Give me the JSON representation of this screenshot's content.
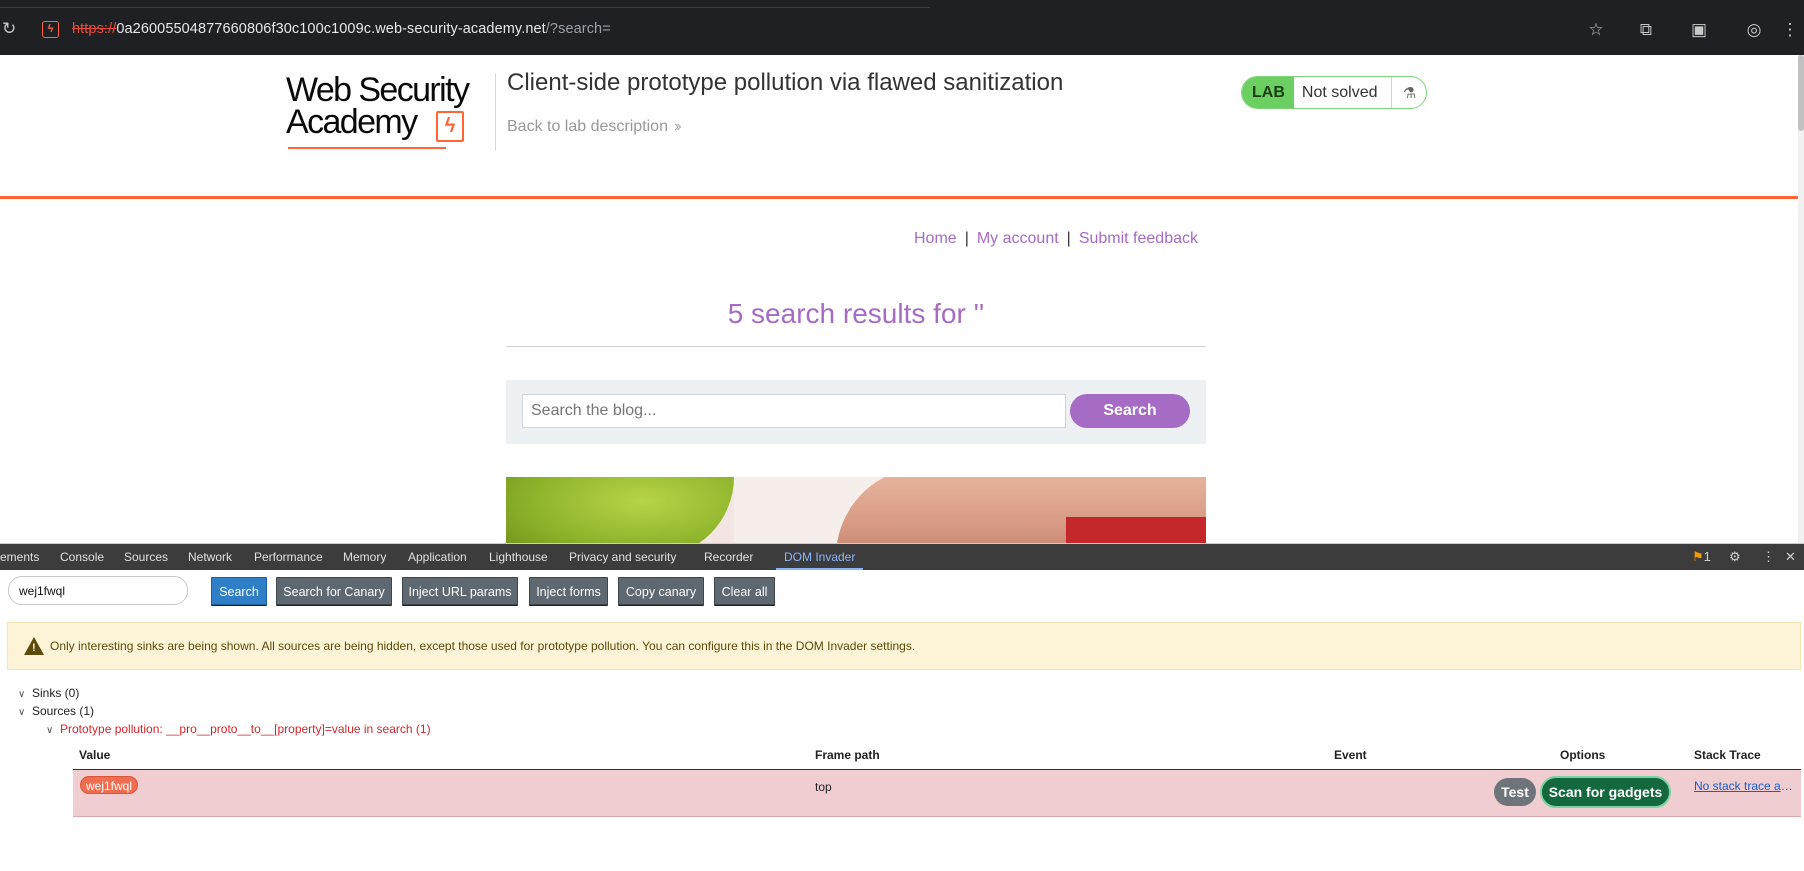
{
  "browser": {
    "url_scheme": "https://",
    "url_host": "0a26005504877660806f30c100c1009c.web-security-academy.net",
    "url_query": "/?search=",
    "icons": [
      "reload-icon",
      "site-icon",
      "star-icon",
      "extensions-icon",
      "media-icon",
      "profile-icon",
      "menu-icon"
    ]
  },
  "header": {
    "logo_line1": "Web Security",
    "logo_line2": "Academy",
    "lab_title": "Client-side prototype pollution via flawed sanitization",
    "back_link": "Back to lab description",
    "lab_badge": "LAB",
    "lab_status": "Not solved"
  },
  "nav": {
    "home": "Home",
    "account": "My account",
    "feedback": "Submit feedback",
    "separator": "|"
  },
  "results": {
    "title": "5 search results for ''"
  },
  "search": {
    "placeholder": "Search the blog...",
    "button": "Search"
  },
  "devtools": {
    "tabs": [
      "ements",
      "Console",
      "Sources",
      "Network",
      "Performance",
      "Memory",
      "Application",
      "Lighthouse",
      "Privacy and security",
      "Recorder",
      "DOM Invader"
    ],
    "active_tab": "DOM Invader",
    "issues_count": "1",
    "canary_value": "wej1fwql",
    "buttons": {
      "search": "Search",
      "search_canary": "Search for Canary",
      "inject_url": "Inject URL params",
      "inject_forms": "Inject forms",
      "copy_canary": "Copy canary",
      "clear_all": "Clear all"
    },
    "warning": "Only interesting sinks are being shown. All sources are being hidden, except those used for prototype pollution. You can configure this in the DOM Invader settings.",
    "tree": {
      "sinks": "Sinks (0)",
      "sources": "Sources (1)",
      "pollution": "Prototype pollution: __pro__proto__to__[property]=value in search (1)"
    },
    "table": {
      "headers": {
        "value": "Value",
        "frame_path": "Frame path",
        "event": "Event",
        "options": "Options",
        "stack_trace": "Stack Trace"
      },
      "rows": [
        {
          "value": "wej1fwql",
          "frame_path": "top",
          "event": "",
          "test": "Test",
          "scan": "Scan for gadgets",
          "stack": "No stack trace available"
        }
      ]
    }
  },
  "colors": {
    "brand_orange": "#ff6633",
    "purple": "#a66bc4",
    "lab_green": "#6ccf62",
    "warning_bg": "#fdf4d7",
    "row_highlight": "#f0cdd0",
    "scan_green": "#14683e"
  }
}
